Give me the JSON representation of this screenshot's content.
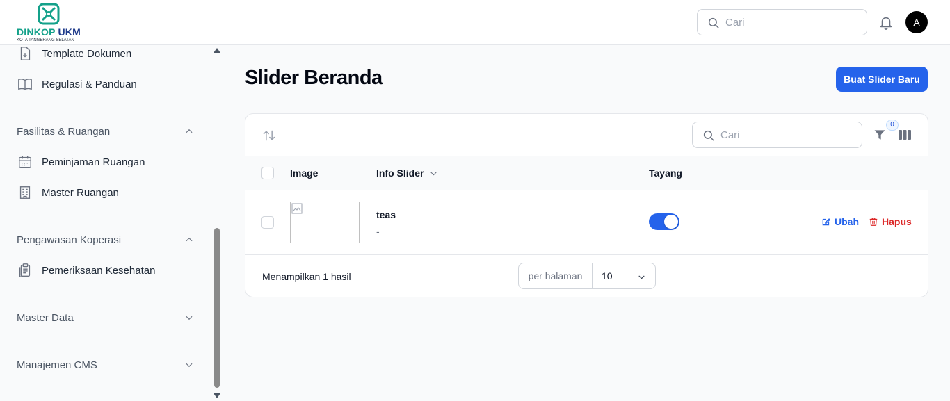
{
  "logo": {
    "brand_a": "DINKOP",
    "brand_b": "UKM",
    "tagline": "KOTA TANGERANG SELATAN"
  },
  "header": {
    "search_placeholder": "Cari",
    "avatar_initial": "A"
  },
  "sidebar": {
    "items": [
      {
        "label": "Template Dokumen",
        "icon": "document-download-icon"
      },
      {
        "label": "Regulasi & Panduan",
        "icon": "book-open-icon"
      }
    ],
    "groups": [
      {
        "label": "Fasilitas & Ruangan",
        "expanded": true,
        "items": [
          {
            "label": "Peminjaman Ruangan",
            "icon": "calendar-icon"
          },
          {
            "label": "Master Ruangan",
            "icon": "building-icon"
          }
        ]
      },
      {
        "label": "Pengawasan Koperasi",
        "expanded": true,
        "items": [
          {
            "label": "Pemeriksaan Kesehatan",
            "icon": "clipboard-icon"
          }
        ]
      },
      {
        "label": "Master Data",
        "expanded": false,
        "items": []
      },
      {
        "label": "Manajemen CMS",
        "expanded": false,
        "items": []
      }
    ]
  },
  "main": {
    "title": "Slider Beranda",
    "new_button": "Buat Slider Baru",
    "table": {
      "search_placeholder": "Cari",
      "filter_count": "0",
      "columns": {
        "image": "Image",
        "info": "Info Slider",
        "tayang": "Tayang"
      },
      "rows": [
        {
          "title": "teas",
          "subtitle": "-",
          "tayang": true,
          "edit_label": "Ubah",
          "delete_label": "Hapus"
        }
      ],
      "footer": {
        "result_text": "Menampilkan 1 hasil",
        "per_page_label": "per halaman",
        "per_page_value": "10"
      }
    }
  },
  "colors": {
    "primary": "#2563eb",
    "danger": "#dc2626",
    "brand_green": "#14a18a",
    "brand_navy": "#1e3a8a"
  }
}
